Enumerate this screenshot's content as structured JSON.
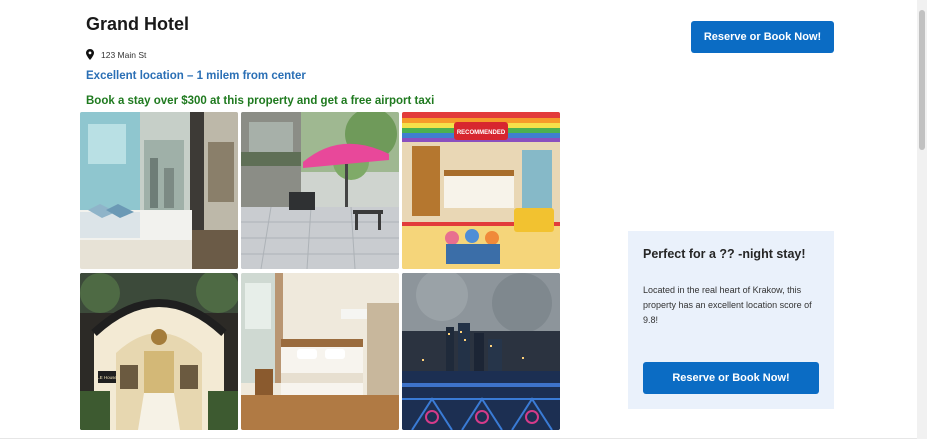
{
  "hotel": {
    "name": "Grand Hotel",
    "address": "123 Main St",
    "location_note": "Excellent location – 1 milem from center",
    "promo": "Book a stay over $300 at this property and get a free airport taxi"
  },
  "header": {
    "reserve_label": "Reserve or Book Now!"
  },
  "gallery": {
    "badge_text": "RECOMMENDED",
    "sign_text": "LE House",
    "photos": [
      {
        "name": "bedroom-city-view"
      },
      {
        "name": "terrace-umbrella"
      },
      {
        "name": "colorful-themed-room"
      },
      {
        "name": "arched-entrance"
      },
      {
        "name": "warm-bedroom"
      },
      {
        "name": "river-night-view"
      }
    ]
  },
  "stay_card": {
    "title": "Perfect for a ?? -night stay!",
    "description": "Located in the real heart of Krakow, this property has an excellent location score of 9.8!",
    "reserve_label": "Reserve or Book Now!"
  },
  "colors": {
    "primary_button": "#0b6cc4",
    "location_text": "#2a6fb5",
    "promo_text": "#1f7a1f",
    "card_background": "#eaf1fb"
  },
  "icons": {
    "address": "map-pin-icon"
  }
}
